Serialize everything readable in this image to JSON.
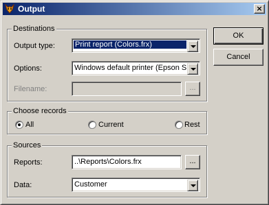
{
  "window": {
    "title": "Output",
    "close_glyph": "×"
  },
  "groups": {
    "destinations": "Destinations",
    "choose_records": "Choose records",
    "sources": "Sources"
  },
  "destinations": {
    "output_type_label": "Output type:",
    "output_type_value": "Print report (Colors.frx)",
    "options_label": "Options:",
    "options_value": "Windows default printer (Epson Sty",
    "filename_label": "Filename:",
    "filename_value": "",
    "browse_label": "..."
  },
  "records": {
    "all": "All",
    "current": "Current",
    "rest": "Rest",
    "selected": "All"
  },
  "sources": {
    "reports_label": "Reports:",
    "reports_value": "..\\Reports\\Colors.frx",
    "browse_label": "...",
    "data_label": "Data:",
    "data_value": "Customer"
  },
  "buttons": {
    "ok": "OK",
    "cancel": "Cancel"
  }
}
